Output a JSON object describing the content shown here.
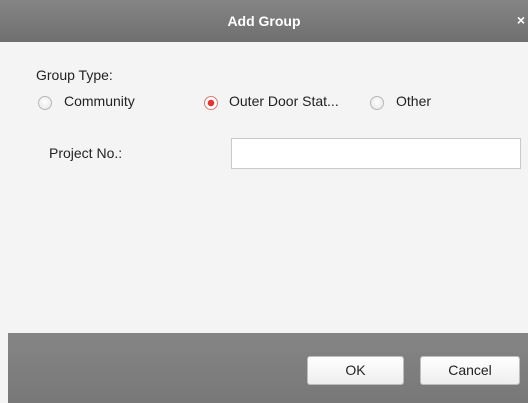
{
  "dialog": {
    "title": "Add Group",
    "close_glyph": "×",
    "group_type_label": "Group Type:",
    "group_type_options": [
      {
        "label": "Community",
        "selected": false
      },
      {
        "label": "Outer Door Stat...",
        "selected": true
      },
      {
        "label": "Other",
        "selected": false
      }
    ],
    "project_no_label": "Project No.:",
    "project_no_value": "",
    "ok_label": "OK",
    "cancel_label": "Cancel"
  },
  "colors": {
    "titlebar": "#7b7b7b",
    "footer": "#808080",
    "radio_selected": "#e8322f"
  }
}
